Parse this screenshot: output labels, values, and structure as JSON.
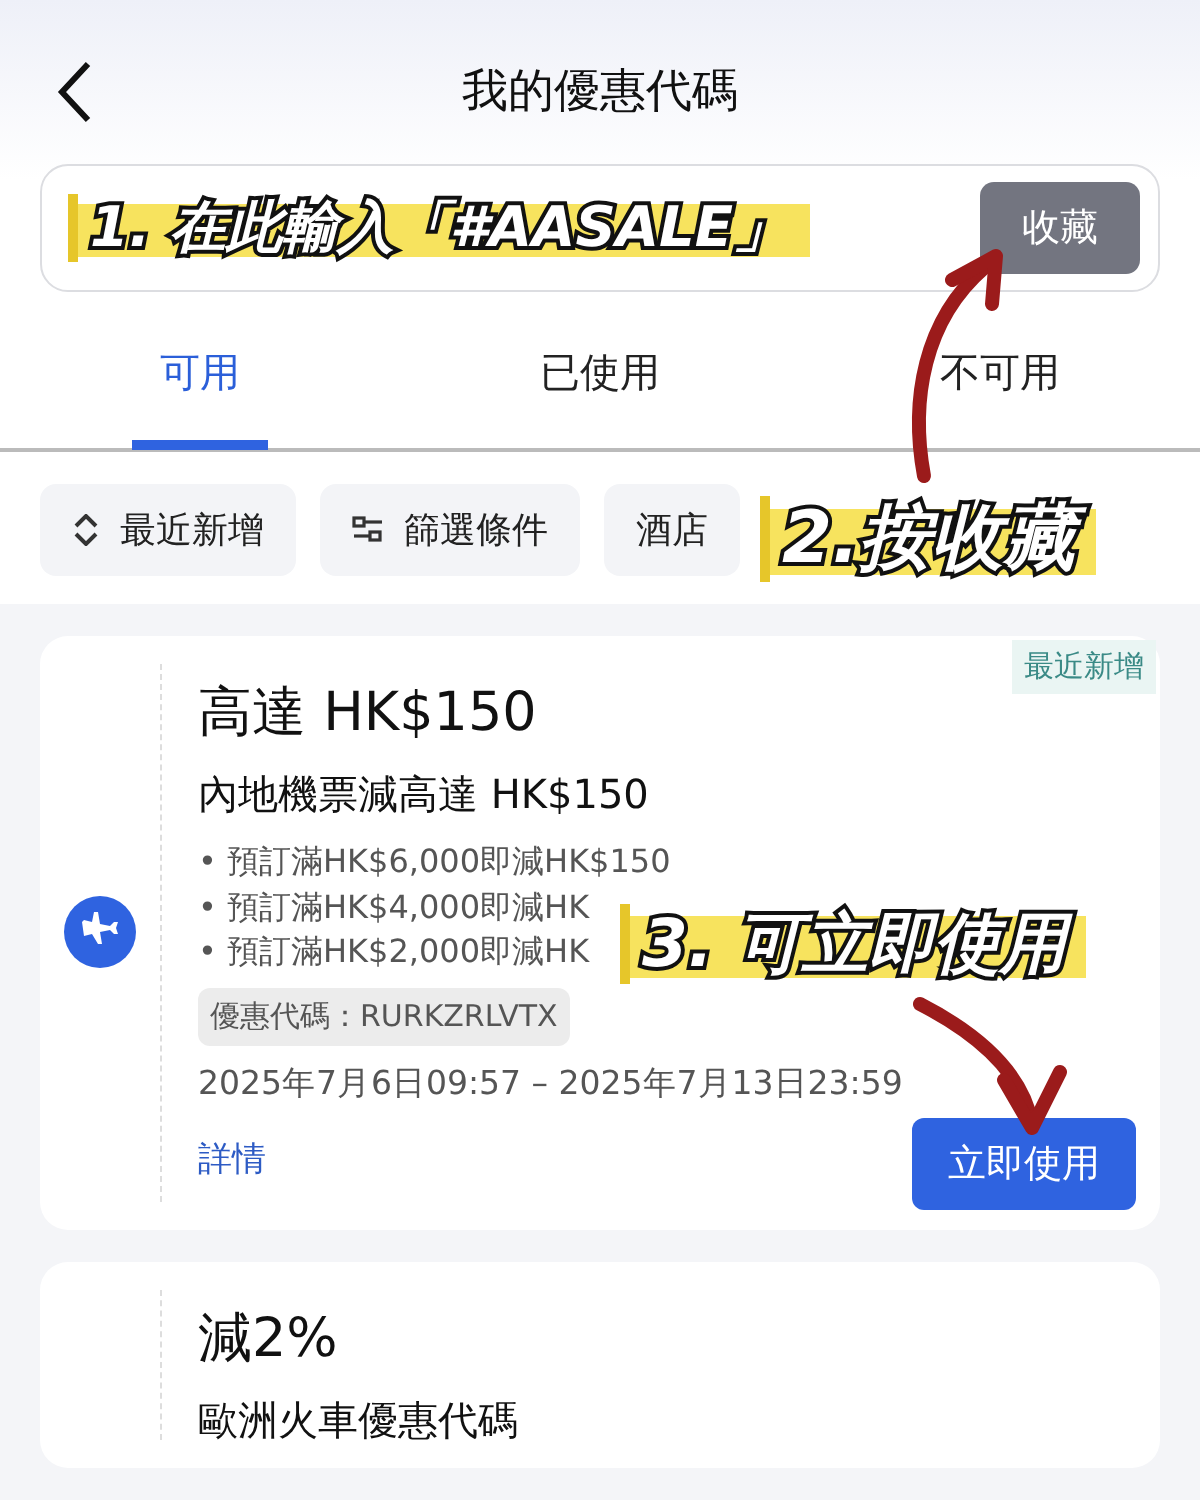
{
  "header": {
    "title": "我的優惠代碼"
  },
  "code_input": {
    "button": "收藏"
  },
  "tabs": [
    {
      "label": "可用",
      "selected": true
    },
    {
      "label": "已使用",
      "selected": false
    },
    {
      "label": "不可用",
      "selected": false
    }
  ],
  "filters": [
    {
      "label": "最近新增",
      "kind": "sort"
    },
    {
      "label": "篩選條件",
      "kind": "filter"
    },
    {
      "label": "酒店",
      "kind": "plain"
    }
  ],
  "coupons": [
    {
      "tag": "最近新增",
      "title": "高達 HK$150",
      "subtitle": "內地機票減高達 HK$150",
      "conditions": [
        "• 預訂滿HK$6,000即減HK$150",
        "• 預訂滿HK$4,000即減HK",
        "• 預訂滿HK$2,000即減HK"
      ],
      "code": "優惠代碼：RURKZRLVTX",
      "period": "2025年7月6日09:57 – 2025年7月13日23:59",
      "details": "詳情",
      "action": "立即使用",
      "kind": "flight"
    },
    {
      "title": "減2%",
      "subtitle": "歐洲火車優惠代碼",
      "kind": "train"
    }
  ],
  "annotations": [
    {
      "text": "1. 在此輸入「#AASALE」"
    },
    {
      "text": "2.按收藏"
    },
    {
      "text": "3. 可立即使用"
    }
  ]
}
